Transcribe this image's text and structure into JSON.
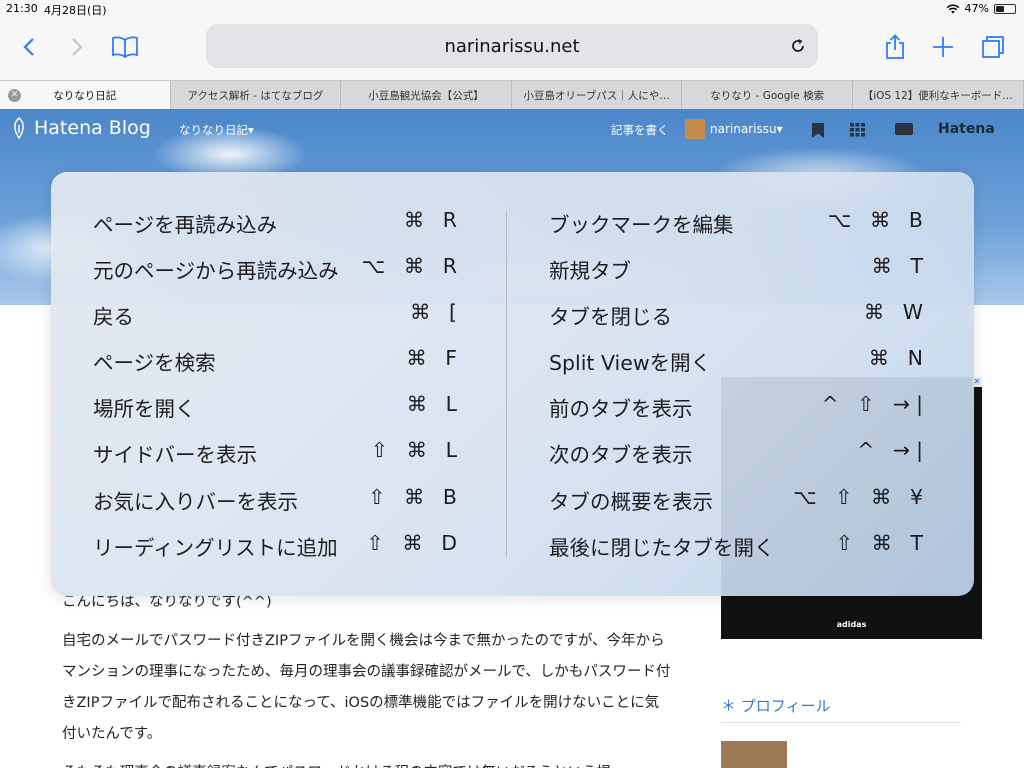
{
  "status_bar": {
    "time": "21:30",
    "date": "4月28日(日)",
    "battery": "47%",
    "battery_level": 0.47
  },
  "toolbar": {
    "url": "narinarissu.net"
  },
  "tabs": [
    {
      "label": "なりなり日記",
      "active": true
    },
    {
      "label": "アクセス解析 - はてなブログ",
      "active": false
    },
    {
      "label": "小豆島観光協会【公式】",
      "active": false
    },
    {
      "label": "小豆島オリーブパス｜人にや…",
      "active": false
    },
    {
      "label": "なりなり - Google 検索",
      "active": false
    },
    {
      "label": "【iOS 12】便利なキーボード…",
      "active": false
    }
  ],
  "blog_header": {
    "logo": "Hatena Blog",
    "blog_name": "なりなり日記▾",
    "write_link": "記事を書く",
    "username": "narinarissu▾",
    "hatena": "Hatena"
  },
  "article": {
    "p1": "こんにちは、なりなりです(^^)",
    "p2": "自宅のメールでパスワード付きZIPファイルを開く機会は今まで無かったのですが、今年からマンションの理事になったため、毎月の理事会の議事録確認がメールで、しかもパスワード付きZIPファイルで配布されることになって、iOSの標準機能ではファイルを開けないことに気付いたんです。",
    "p3": "そもそも理事会の議事録案なんてパスワードかける程の内容では無いだろうという提"
  },
  "sidebar": {
    "ad_brand": "adidas",
    "profile_heading": "＊ プロフィール"
  },
  "shortcuts": {
    "left": [
      {
        "label": "ページを再読み込み",
        "keys": "⌘ R"
      },
      {
        "label": "元のページから再読み込み",
        "keys": "⌥ ⌘ R"
      },
      {
        "label": "戻る",
        "keys": "⌘ ["
      },
      {
        "label": "ページを検索",
        "keys": "⌘ F"
      },
      {
        "label": "場所を開く",
        "keys": "⌘ L"
      },
      {
        "label": "サイドバーを表示",
        "keys": "⇧ ⌘ L"
      },
      {
        "label": "お気に入りバーを表示",
        "keys": "⇧ ⌘ B"
      },
      {
        "label": "リーディングリストに追加",
        "keys": "⇧ ⌘ D"
      }
    ],
    "right": [
      {
        "label": "ブックマークを編集",
        "keys": "⌥ ⌘ B"
      },
      {
        "label": "新規タブ",
        "keys": "⌘ T"
      },
      {
        "label": "タブを閉じる",
        "keys": "⌘ W"
      },
      {
        "label": "Split Viewを開く",
        "keys": "⌘ N"
      },
      {
        "label": "前のタブを表示",
        "keys": "^ ⇧ →|"
      },
      {
        "label": "次のタブを表示",
        "keys": "^ →|"
      },
      {
        "label": "タブの概要を表示",
        "keys": "⌥ ⇧ ⌘ ¥"
      },
      {
        "label": "最後に閉じたタブを開く",
        "keys": "⇧ ⌘ T"
      }
    ]
  },
  "colors": {
    "accent": "#2f7cf6",
    "toolbar_bg": "#f7f7f7",
    "tab_bg": "#d8d8da"
  }
}
